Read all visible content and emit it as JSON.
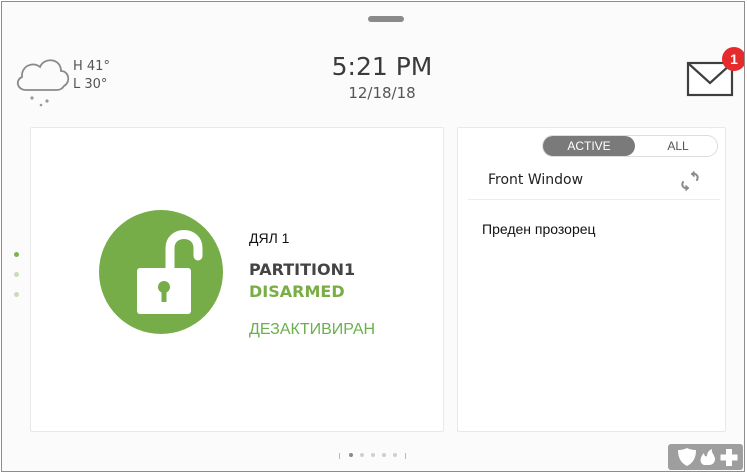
{
  "weather": {
    "icon": "cloud-snow-icon",
    "high": "H 41°",
    "low": "L 30°"
  },
  "clock": {
    "time": "5:21 PM",
    "date": "12/18/18"
  },
  "messages": {
    "icon": "mail-icon",
    "count": "1",
    "badge_color": "#e52b2b"
  },
  "partition": {
    "label_bg": "ДЯЛ 1",
    "name": "PARTITION1",
    "status": "DISARMED",
    "status_bg": "ДЕЗАКТИВИРАН",
    "lock_icon": "unlocked-padlock-icon",
    "status_color": "#79ad46"
  },
  "zones": {
    "tabs": {
      "active": "ACTIVE",
      "all": "ALL"
    },
    "items": [
      {
        "name": "Front Window",
        "icon": "window-open-icon",
        "translation": "Преден прозорец"
      }
    ]
  },
  "emergency": {
    "icons": [
      "police-shield-icon",
      "fire-icon",
      "medical-cross-icon"
    ]
  }
}
